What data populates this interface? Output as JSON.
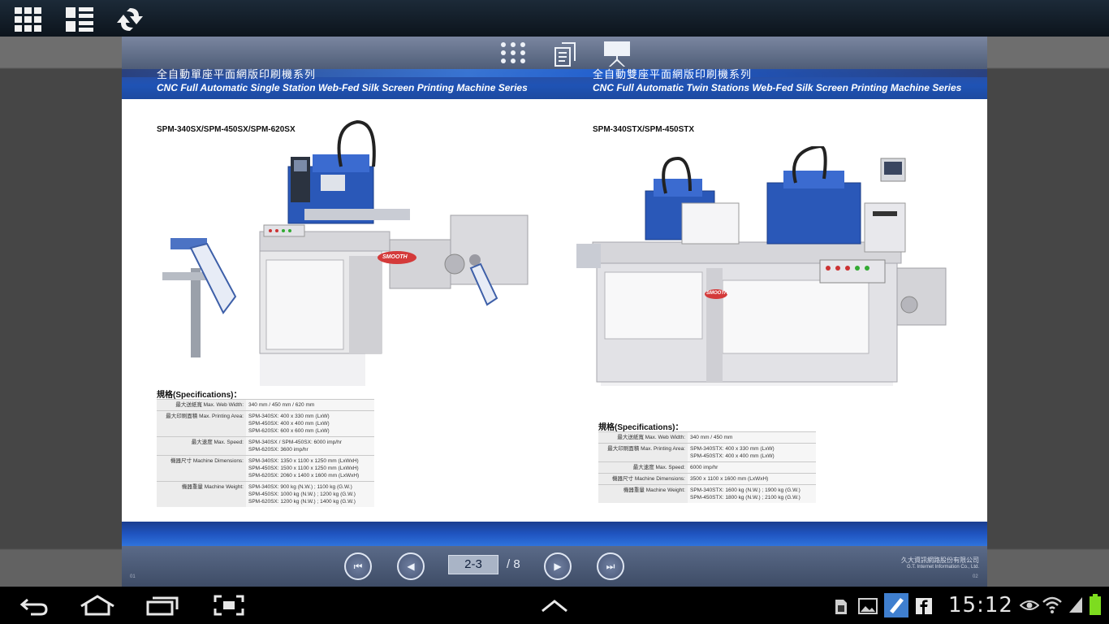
{
  "spread": {
    "left": {
      "title_zh": "全自動單座平面網版印刷機系列",
      "title_en": "CNC Full Automatic Single Station Web-Fed Silk Screen Printing Machine Series",
      "model": "SPM-340SX/SPM-450SX/SPM-620SX",
      "brand": "SMOOTH",
      "spec_title": "規格(Specifications)：",
      "specs": [
        {
          "label": "最大送紙寬 Max. Web Width:",
          "value": "340 mm / 450 mm / 620 mm"
        },
        {
          "label": "最大印刷面積 Max. Printing Area:",
          "value": "SPM-340SX: 400 x 330 mm (LxW)\nSPM-450SX: 400 x 400 mm (LxW)\nSPM-620SX: 600 x 600 mm (LxW)"
        },
        {
          "label": "最大速度 Max. Speed:",
          "value": "SPM-340SX / SPM-450SX: 6000 imp/hr\nSPM-620SX: 3600 imp/hr"
        },
        {
          "label": "機器尺寸 Machine Dimensions:",
          "value": "SPM-340SX: 1350 x 1100 x 1250 mm (LxWxH)\nSPM-450SX: 1500 x 1100 x 1250 mm (LxWxH)\nSPM-620SX: 2060 x 1400 x 1600 mm (LxWxH)"
        },
        {
          "label": "機器重量 Machine Weight:",
          "value": "SPM-340SX:  900 kg (N.W.) ; 1100 kg (G.W.)\nSPM-450SX: 1000 kg (N.W.) ; 1200 kg (G.W.)\nSPM-620SX: 1200 kg (N.W.) ; 1400 kg (G.W.)"
        }
      ]
    },
    "right": {
      "title_zh": "全自動雙座平面網版印刷機系列",
      "title_en": "CNC Full Automatic Twin Stations Web-Fed Silk Screen Printing Machine Series",
      "model": "SPM-340STX/SPM-450STX",
      "brand": "SMOOTH",
      "spec_title": "規格(Specifications)：",
      "specs": [
        {
          "label": "最大送紙寬 Max. Web Width:",
          "value": "340 mm / 450 mm"
        },
        {
          "label": "最大印刷面積 Max. Printing Area:",
          "value": "SPM-340STX: 400 x 330 mm (LxW)\nSPM-450STX: 400 x 400 mm (LxW)"
        },
        {
          "label": "最大速度 Max. Speed:",
          "value": "6000 imp/hr"
        },
        {
          "label": "機器尺寸 Machine Dimensions:",
          "value": "3500 x 1100 x 1600 mm (LxWxH)"
        },
        {
          "label": "機器重量 Machine Weight:",
          "value": "SPM-340STX: 1600 kg (N.W.) ; 1900 kg (G.W.)\nSPM-450STX: 1800 kg (N.W.) ; 2100 kg (G.W.)"
        }
      ]
    },
    "page_number_left": "01",
    "page_number_right": "02"
  },
  "navigation": {
    "current_page": "2-3",
    "total_pages": "/ 8"
  },
  "company": {
    "name_zh": "久大資訊網路股份有限公司",
    "name_en": "G.T. Internet Information Co., Ltd."
  },
  "statusbar": {
    "time": "15:12"
  },
  "icons": {
    "top": [
      "grid-view-icon",
      "list-view-icon",
      "refresh-icon"
    ],
    "toolbar": [
      "thumbnails-icon",
      "copy-icon",
      "slideshow-icon"
    ],
    "nav": [
      "first-page-icon",
      "previous-page-icon",
      "next-page-icon",
      "last-page-icon"
    ],
    "system": [
      "back-icon",
      "home-icon",
      "recent-apps-icon",
      "screenshot-icon",
      "up-arrow-icon"
    ],
    "status": [
      "sd-card-icon",
      "gallery-icon",
      "notes-icon",
      "facebook-icon",
      "eye-icon",
      "wifi-icon",
      "signal-icon",
      "battery-icon"
    ]
  },
  "colors": {
    "header_blue": "#1f53b5",
    "footer_blue": "#1f54c0",
    "machine_blue": "#2a58b8",
    "battery_green": "#7ddc1f"
  }
}
